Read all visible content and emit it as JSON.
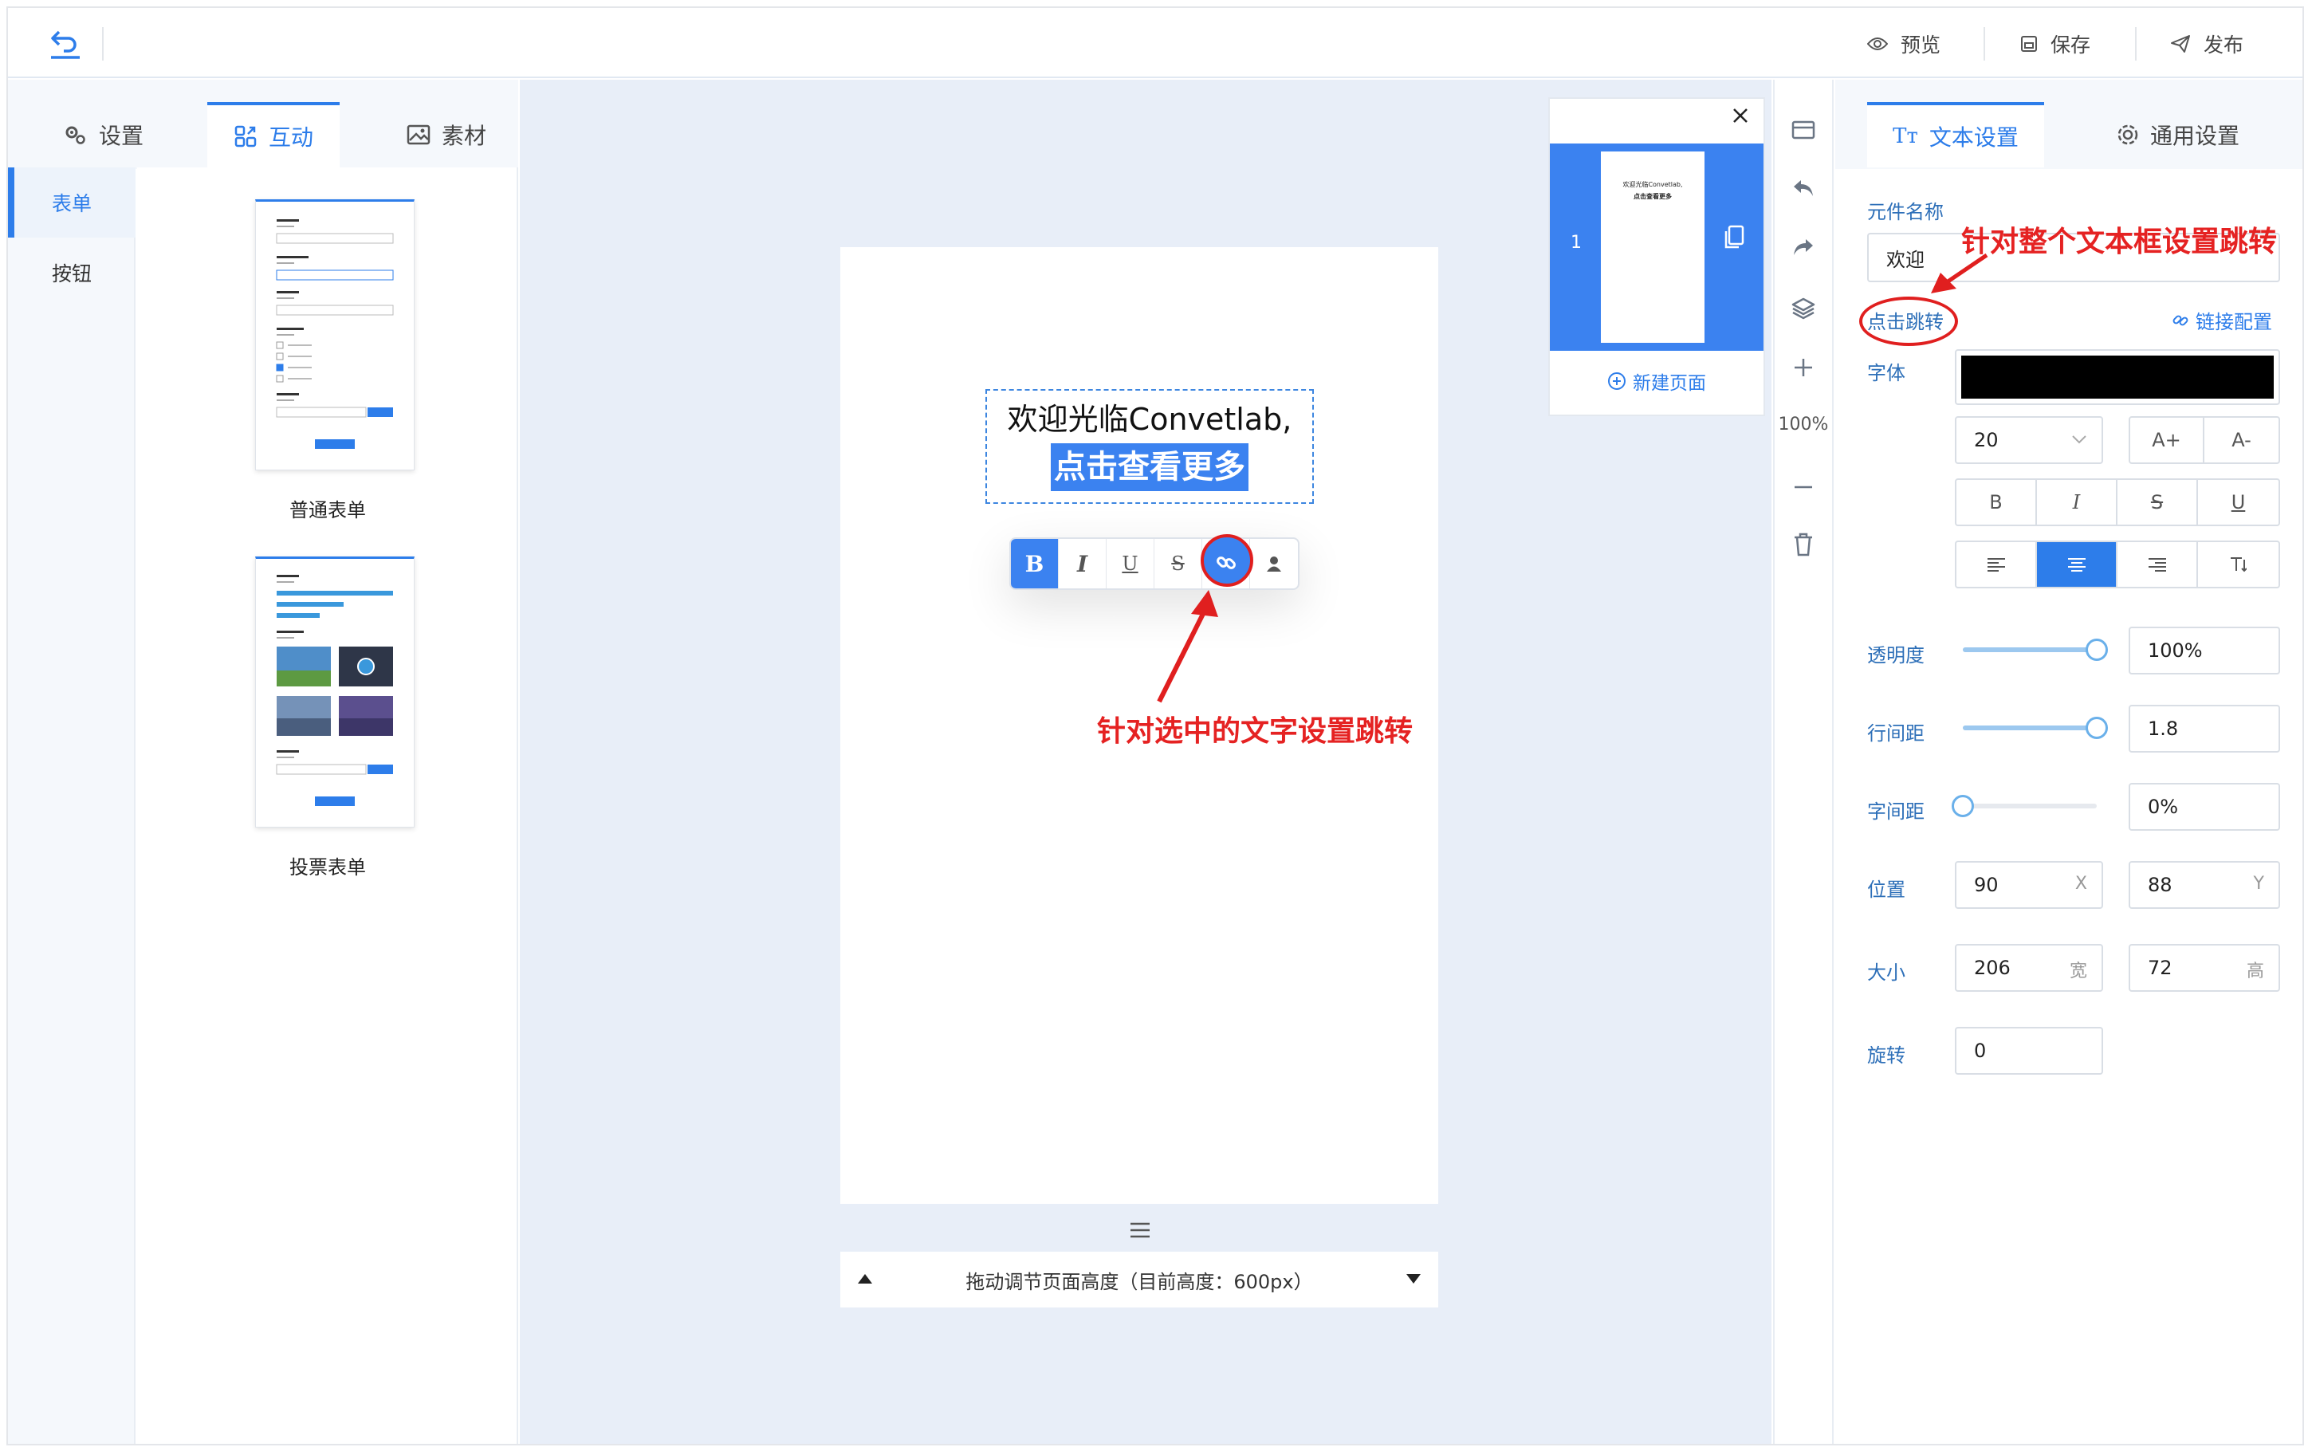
{
  "topbar": {
    "preview_label": "预览",
    "save_label": "保存",
    "publish_label": "发布"
  },
  "left_panel": {
    "tabs": [
      {
        "label": "设置",
        "icon": "gears-icon"
      },
      {
        "label": "互动",
        "icon": "interaction-icon"
      },
      {
        "label": "素材",
        "icon": "image-icon"
      }
    ],
    "active_tab": "互动",
    "nav": [
      "表单",
      "按钮"
    ],
    "active_nav": "表单",
    "templates": [
      {
        "label": "普通表单"
      },
      {
        "label": "投票表单"
      }
    ]
  },
  "canvas": {
    "text_line1": "欢迎光临Convetlab,",
    "text_line2": "点击查看更多",
    "toolbar": {
      "bold": "B",
      "italic": "I",
      "underline": "U",
      "strike": "S"
    },
    "resize_label": "拖动调节页面高度（目前高度：600px）",
    "annotation_selected": "针对选中的文字设置跳转"
  },
  "pages_panel": {
    "page_number": "1",
    "thumb_line1": "欢迎光临Convetlab,",
    "thumb_line2": "点击查看更多",
    "new_page_label": "新建页面"
  },
  "toolstrip": {
    "zoom": "100%"
  },
  "right_panel": {
    "tabs": [
      {
        "label": "文本设置",
        "icon": "text-icon"
      },
      {
        "label": "通用设置",
        "icon": "gear-icon"
      }
    ],
    "active_tab": "文本设置",
    "component_name_label": "元件名称",
    "component_name_value": "欢迎",
    "annotation_whole": "针对整个文本框设置跳转",
    "click_jump_label": "点击跳转",
    "link_config_label": "链接配置",
    "font_label": "字体",
    "font_color": "#000000",
    "font_size": "20",
    "font_plus": "A+",
    "font_minus": "A-",
    "style_buttons": [
      "B",
      "I",
      "S",
      "U"
    ],
    "opacity_label": "透明度",
    "opacity_value": "100%",
    "opacity_fraction": 1.0,
    "line_height_label": "行间距",
    "line_height_value": "1.8",
    "line_height_fraction": 1.0,
    "letter_spacing_label": "字间距",
    "letter_spacing_value": "0%",
    "letter_spacing_fraction": 0.0,
    "position_label": "位置",
    "pos_x": "90",
    "pos_x_unit": "X",
    "pos_y": "88",
    "pos_y_unit": "Y",
    "size_label": "大小",
    "width": "206",
    "width_unit": "宽",
    "height": "72",
    "height_unit": "高",
    "rotate_label": "旋转",
    "rotate_value": "0"
  },
  "colors": {
    "accent": "#2d7dea",
    "annotation": "#e52222"
  }
}
